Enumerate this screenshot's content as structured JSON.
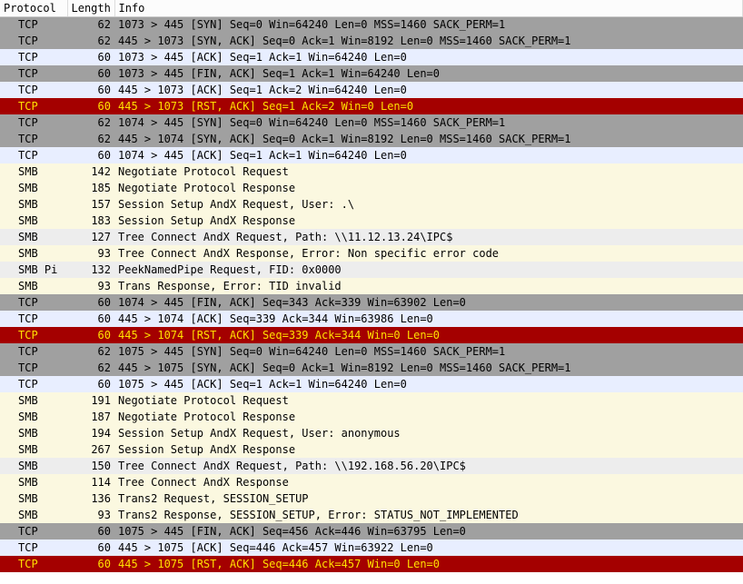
{
  "columns": {
    "protocol": "Protocol",
    "length": "Length",
    "info": "Info"
  },
  "rows": [
    {
      "rowclass": "bg-gray",
      "protocol": "TCP",
      "length": "62",
      "info": "1073 > 445 [SYN] Seq=0 Win=64240 Len=0 MSS=1460 SACK_PERM=1"
    },
    {
      "rowclass": "bg-gray",
      "protocol": "TCP",
      "length": "62",
      "info": "445 > 1073 [SYN, ACK] Seq=0 Ack=1 Win=8192 Len=0 MSS=1460 SACK_PERM=1"
    },
    {
      "rowclass": "bg-ltblue",
      "protocol": "TCP",
      "length": "60",
      "info": "1073 > 445 [ACK] Seq=1 Ack=1 Win=64240 Len=0"
    },
    {
      "rowclass": "bg-gray",
      "protocol": "TCP",
      "length": "60",
      "info": "1073 > 445 [FIN, ACK] Seq=1 Ack=1 Win=64240 Len=0"
    },
    {
      "rowclass": "bg-ltblue",
      "protocol": "TCP",
      "length": "60",
      "info": "445 > 1073 [ACK] Seq=1 Ack=2 Win=64240 Len=0"
    },
    {
      "rowclass": "bg-red",
      "protocol": "TCP",
      "length": "60",
      "info": "445 > 1073 [RST, ACK] Seq=1 Ack=2 Win=0 Len=0"
    },
    {
      "rowclass": "bg-gray",
      "protocol": "TCP",
      "length": "62",
      "info": "1074 > 445 [SYN] Seq=0 Win=64240 Len=0 MSS=1460 SACK_PERM=1"
    },
    {
      "rowclass": "bg-gray",
      "protocol": "TCP",
      "length": "62",
      "info": "445 > 1074 [SYN, ACK] Seq=0 Ack=1 Win=8192 Len=0 MSS=1460 SACK_PERM=1"
    },
    {
      "rowclass": "bg-ltblue",
      "protocol": "TCP",
      "length": "60",
      "info": "1074 > 445 [ACK] Seq=1 Ack=1 Win=64240 Len=0"
    },
    {
      "rowclass": "bg-cream",
      "protocol": "SMB",
      "length": "142",
      "info": "Negotiate Protocol Request"
    },
    {
      "rowclass": "bg-cream",
      "protocol": "SMB",
      "length": "185",
      "info": "Negotiate Protocol Response"
    },
    {
      "rowclass": "bg-cream",
      "protocol": "SMB",
      "length": "157",
      "info": "Session Setup AndX Request, User: .\\"
    },
    {
      "rowclass": "bg-cream",
      "protocol": "SMB",
      "length": "183",
      "info": "Session Setup AndX Response"
    },
    {
      "rowclass": "bg-ltgray",
      "protocol": "SMB",
      "length": "127",
      "info": "Tree Connect AndX Request, Path: \\\\11.12.13.24\\IPC$"
    },
    {
      "rowclass": "bg-cream",
      "protocol": "SMB",
      "length": "93",
      "info": "Tree Connect AndX Response, Error: Non specific error code"
    },
    {
      "rowclass": "bg-ltgray",
      "protocol": "SMB Pi",
      "length": "132",
      "info": "PeekNamedPipe Request, FID: 0x0000"
    },
    {
      "rowclass": "bg-cream",
      "protocol": "SMB",
      "length": "93",
      "info": "Trans Response, Error: TID invalid"
    },
    {
      "rowclass": "bg-gray",
      "protocol": "TCP",
      "length": "60",
      "info": "1074 > 445 [FIN, ACK] Seq=343 Ack=339 Win=63902 Len=0"
    },
    {
      "rowclass": "bg-ltblue",
      "protocol": "TCP",
      "length": "60",
      "info": "445 > 1074 [ACK] Seq=339 Ack=344 Win=63986 Len=0"
    },
    {
      "rowclass": "bg-red",
      "protocol": "TCP",
      "length": "60",
      "info": "445 > 1074 [RST, ACK] Seq=339 Ack=344 Win=0 Len=0"
    },
    {
      "rowclass": "bg-gray",
      "protocol": "TCP",
      "length": "62",
      "info": "1075 > 445 [SYN] Seq=0 Win=64240 Len=0 MSS=1460 SACK_PERM=1"
    },
    {
      "rowclass": "bg-gray",
      "protocol": "TCP",
      "length": "62",
      "info": "445 > 1075 [SYN, ACK] Seq=0 Ack=1 Win=8192 Len=0 MSS=1460 SACK_PERM=1"
    },
    {
      "rowclass": "bg-ltblue",
      "protocol": "TCP",
      "length": "60",
      "info": "1075 > 445 [ACK] Seq=1 Ack=1 Win=64240 Len=0"
    },
    {
      "rowclass": "bg-cream",
      "protocol": "SMB",
      "length": "191",
      "info": "Negotiate Protocol Request"
    },
    {
      "rowclass": "bg-cream",
      "protocol": "SMB",
      "length": "187",
      "info": "Negotiate Protocol Response"
    },
    {
      "rowclass": "bg-cream",
      "protocol": "SMB",
      "length": "194",
      "info": "Session Setup AndX Request, User: anonymous"
    },
    {
      "rowclass": "bg-cream",
      "protocol": "SMB",
      "length": "267",
      "info": "Session Setup AndX Response"
    },
    {
      "rowclass": "bg-ltgray",
      "protocol": "SMB",
      "length": "150",
      "info": "Tree Connect AndX Request, Path: \\\\192.168.56.20\\IPC$"
    },
    {
      "rowclass": "bg-cream",
      "protocol": "SMB",
      "length": "114",
      "info": "Tree Connect AndX Response"
    },
    {
      "rowclass": "bg-cream",
      "protocol": "SMB",
      "length": "136",
      "info": "Trans2 Request, SESSION_SETUP"
    },
    {
      "rowclass": "bg-cream",
      "protocol": "SMB",
      "length": "93",
      "info": "Trans2 Response, SESSION_SETUP, Error: STATUS_NOT_IMPLEMENTED"
    },
    {
      "rowclass": "bg-gray",
      "protocol": "TCP",
      "length": "60",
      "info": "1075 > 445 [FIN, ACK] Seq=456 Ack=446 Win=63795 Len=0"
    },
    {
      "rowclass": "bg-ltblue",
      "protocol": "TCP",
      "length": "60",
      "info": "445 > 1075 [ACK] Seq=446 Ack=457 Win=63922 Len=0"
    },
    {
      "rowclass": "bg-red",
      "protocol": "TCP",
      "length": "60",
      "info": "445 > 1075 [RST, ACK] Seq=446 Ack=457 Win=0 Len=0"
    }
  ]
}
